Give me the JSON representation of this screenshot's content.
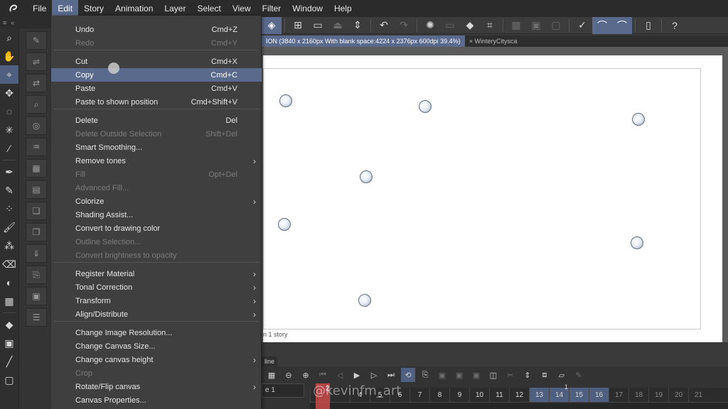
{
  "menubar": {
    "items": [
      "File",
      "Edit",
      "Story",
      "Animation",
      "Layer",
      "Select",
      "View",
      "Filter",
      "Window",
      "Help"
    ],
    "active_index": 1
  },
  "tabs": [
    {
      "label": "ION (3840 x 2160px With blank space:4224 x 2376px 600dpi 39.4%)",
      "active": true
    },
    {
      "label": "× WinteryCitysca",
      "active": false
    }
  ],
  "edit_menu": {
    "groups": [
      [
        {
          "label": "Undo",
          "shortcut": "Cmd+Z",
          "enabled": true
        },
        {
          "label": "Redo",
          "shortcut": "Cmd+Y",
          "enabled": false
        }
      ],
      [
        {
          "label": "Cut",
          "shortcut": "Cmd+X",
          "enabled": true
        },
        {
          "label": "Copy",
          "shortcut": "Cmd+C",
          "enabled": true,
          "hover": true
        },
        {
          "label": "Paste",
          "shortcut": "Cmd+V",
          "enabled": true
        },
        {
          "label": "Paste to shown position",
          "shortcut": "Cmd+Shift+V",
          "enabled": true
        }
      ],
      [
        {
          "label": "Delete",
          "shortcut": "Del",
          "enabled": true
        },
        {
          "label": "Delete Outside Selection",
          "shortcut": "Shift+Del",
          "enabled": false
        },
        {
          "label": "Smart Smoothing...",
          "shortcut": "",
          "enabled": true
        },
        {
          "label": "Remove tones",
          "shortcut": "",
          "enabled": true,
          "submenu": true
        },
        {
          "label": "Fill",
          "shortcut": "Opt+Del",
          "enabled": false
        },
        {
          "label": "Advanced Fill...",
          "shortcut": "",
          "enabled": false
        },
        {
          "label": "Colorize",
          "shortcut": "",
          "enabled": true,
          "submenu": true
        },
        {
          "label": "Shading Assist...",
          "shortcut": "",
          "enabled": true
        },
        {
          "label": "Convert to drawing color",
          "shortcut": "",
          "enabled": true
        },
        {
          "label": "Outline Selection...",
          "shortcut": "",
          "enabled": false
        },
        {
          "label": "Convert brightness to opacity",
          "shortcut": "",
          "enabled": false
        }
      ],
      [
        {
          "label": "Register Material",
          "shortcut": "",
          "enabled": true,
          "submenu": true
        },
        {
          "label": "Tonal Correction",
          "shortcut": "",
          "enabled": true,
          "submenu": true
        },
        {
          "label": "Transform",
          "shortcut": "",
          "enabled": true,
          "submenu": true
        },
        {
          "label": "Align/Distribute",
          "shortcut": "",
          "enabled": true,
          "submenu": true
        }
      ],
      [
        {
          "label": "Change Image Resolution...",
          "shortcut": "",
          "enabled": true
        },
        {
          "label": "Change Canvas Size...",
          "shortcut": "",
          "enabled": true
        },
        {
          "label": "Change canvas height",
          "shortcut": "",
          "enabled": true,
          "submenu": true
        },
        {
          "label": "Crop",
          "shortcut": "",
          "enabled": false
        },
        {
          "label": "Rotate/Flip canvas",
          "shortcut": "",
          "enabled": true,
          "submenu": true
        },
        {
          "label": "Canvas Properties...",
          "shortcut": "",
          "enabled": true
        }
      ]
    ]
  },
  "canvas": {
    "story_label": "n 1 story",
    "handles": 7
  },
  "timeline": {
    "tab_label": "line",
    "track_name": "e 1",
    "frames": [
      "",
      "",
      "4",
      "5",
      "6",
      "7",
      "8",
      "9",
      "10",
      "11",
      "12",
      "13",
      "14",
      "15",
      "16",
      "17",
      "18",
      "19",
      "20",
      "21"
    ],
    "highlight_frames": [
      "13",
      "14",
      "15",
      "16"
    ],
    "dim_frames": [
      "17",
      "18",
      "19",
      "20",
      "21"
    ],
    "marker_label": "1",
    "playhead_label": "2",
    "watermark": "@kevinfm_art"
  },
  "toolbar": {
    "icons": [
      "layer-icon",
      "new-file-icon",
      "open-folder-icon",
      "save-icon",
      "ruler-icon",
      "undo-icon",
      "redo-icon",
      "spinner-icon",
      "clear-icon",
      "fill-icon",
      "crop-icon",
      "frame-icon",
      "frame-icon",
      "frame-icon",
      "pen-icon",
      "brush-icon",
      "brush-icon",
      "phone-icon",
      "help-icon"
    ]
  },
  "colors": {
    "accent": "#5a6a8c",
    "menu_bg": "#3f3f3f",
    "playhead": "#c94a4a"
  }
}
